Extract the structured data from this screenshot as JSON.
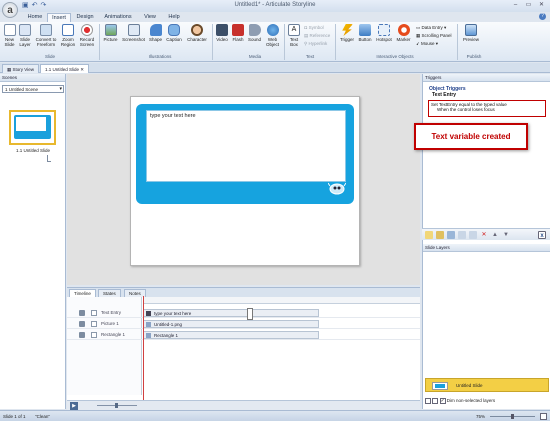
{
  "window": {
    "title": "Untitled1* - Articulate Storyline",
    "app_logo": "a",
    "controls": [
      "–",
      "▭",
      "✕"
    ]
  },
  "ribbon": {
    "tabs": [
      "Home",
      "Insert",
      "Design",
      "Animations",
      "View",
      "Help"
    ],
    "active_tab": "Insert",
    "groups": {
      "slide": {
        "label": "Slide",
        "buttons": [
          "New Slide",
          "Slide Layer",
          "Convert to Freeform",
          "Zoom Region",
          "Record Screen"
        ]
      },
      "illustrations": {
        "label": "Illustrations",
        "buttons": [
          "Picture",
          "Screenshot",
          "Shape",
          "Caption",
          "Character"
        ]
      },
      "media": {
        "label": "Media",
        "buttons": [
          "Video",
          "Flash",
          "Sound",
          "Web Object"
        ]
      },
      "text": {
        "label": "Text",
        "buttons": [
          "Text Box"
        ],
        "small": [
          "Symbol",
          "Reference",
          "Hyperlink"
        ]
      },
      "interactive": {
        "label": "Interactive Objects",
        "buttons": [
          "Trigger",
          "Button",
          "Hotspot",
          "Marker"
        ],
        "small": [
          "Data Entry",
          "Scrolling Panel",
          "Mouse"
        ]
      },
      "publish": {
        "label": "Publish",
        "buttons": [
          "Preview"
        ]
      }
    }
  },
  "doc_tabs": [
    "Story View",
    "1.1 Untitled Slide"
  ],
  "scenes": {
    "header": "Scenes",
    "selected_scene": "1 Untitled Scene",
    "slide_label": "1.1 Untitled Slide"
  },
  "slide": {
    "textbox_text": "type your text here"
  },
  "triggers": {
    "header": "Triggers",
    "section": "Object Triggers",
    "object": "Text Entry",
    "line1": "Set TextEntry equal to the typed value",
    "line2": "When the control loses focus",
    "callout": "Text variable created"
  },
  "layers": {
    "header": "Slide Layers",
    "base_layer": "Untitled Slide",
    "dim_label": "Dim non-selected layers"
  },
  "timeline": {
    "tabs": [
      "Timeline",
      "States",
      "Notes"
    ],
    "rows": [
      {
        "name": "Text Entry",
        "bar": "type your text here"
      },
      {
        "name": "Picture 1",
        "bar": "Untitled-1.png"
      },
      {
        "name": "Rectangle 1",
        "bar": "Rectangle 1"
      }
    ]
  },
  "status": {
    "slide": "Slide 1 of 1",
    "theme": "\"Clean\"",
    "zoom": "75%"
  },
  "colors": {
    "accent_blue": "#16a3df",
    "callout_red": "#c00000",
    "layer_yellow": "#f3cf45"
  }
}
